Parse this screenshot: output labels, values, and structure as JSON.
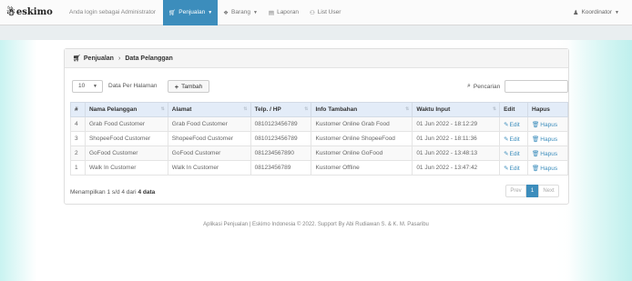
{
  "navbar": {
    "brand": "eskimo",
    "login_text": "Anda login sebagai Administrator",
    "menu": [
      {
        "label": "Penjualan",
        "icon": "cart-icon",
        "active": true
      },
      {
        "label": "Barang",
        "icon": "gift-icon",
        "active": false
      },
      {
        "label": "Laporan",
        "icon": "report-icon",
        "active": false
      },
      {
        "label": "List User",
        "icon": "users-icon",
        "active": false
      }
    ],
    "user": "Koordinator"
  },
  "panel": {
    "breadcrumb": [
      "Penjualan",
      "Data Pelanggan"
    ],
    "page_size": "10",
    "per_page_label": "Data Per Halaman",
    "add_label": "Tambah",
    "search_label": "Pencarian",
    "search_value": "",
    "columns": [
      "#",
      "Nama Pelanggan",
      "Alamat",
      "Telp. / HP",
      "Info Tambahan",
      "Waktu Input",
      "Edit",
      "Hapus"
    ],
    "rows": [
      {
        "no": "4",
        "nama": "Grab Food Customer",
        "alamat": "Grab Food Customer",
        "telp": "0810123456789",
        "info": "Kustomer Online Grab Food",
        "waktu": "01 Jun 2022 - 18:12:29",
        "edit": "Edit",
        "hapus": "Hapus"
      },
      {
        "no": "3",
        "nama": "ShopeeFood Customer",
        "alamat": "ShopeeFood Customer",
        "telp": "0810123456789",
        "info": "Kustomer Online ShopeeFood",
        "waktu": "01 Jun 2022 - 18:11:36",
        "edit": "Edit",
        "hapus": "Hapus"
      },
      {
        "no": "2",
        "nama": "GoFood Customer",
        "alamat": "GoFood Customer",
        "telp": "081234567890",
        "info": "Kustomer Online GoFood",
        "waktu": "01 Jun 2022 - 13:48:13",
        "edit": "Edit",
        "hapus": "Hapus"
      },
      {
        "no": "1",
        "nama": "Walk In Customer",
        "alamat": "Walk In Customer",
        "telp": "08123456789",
        "info": "Kustomer Offline",
        "waktu": "01 Jun 2022 - 13:47:42",
        "edit": "Edit",
        "hapus": "Hapus"
      }
    ],
    "info_prefix": "Menampilkan 1 s/d 4 dari",
    "info_total": "4 data",
    "pager": {
      "prev": "Prev",
      "current": "1",
      "next": "Next"
    }
  },
  "footer": "Aplikasi Penjualan | Eskimo Indonesia © 2022. Support By Abi Rudiawan S. & K. M. Pasaribu",
  "colors": {
    "accent": "#3c8dbc",
    "background": "#5fd9d3",
    "table_header": "#e3ecf8"
  }
}
